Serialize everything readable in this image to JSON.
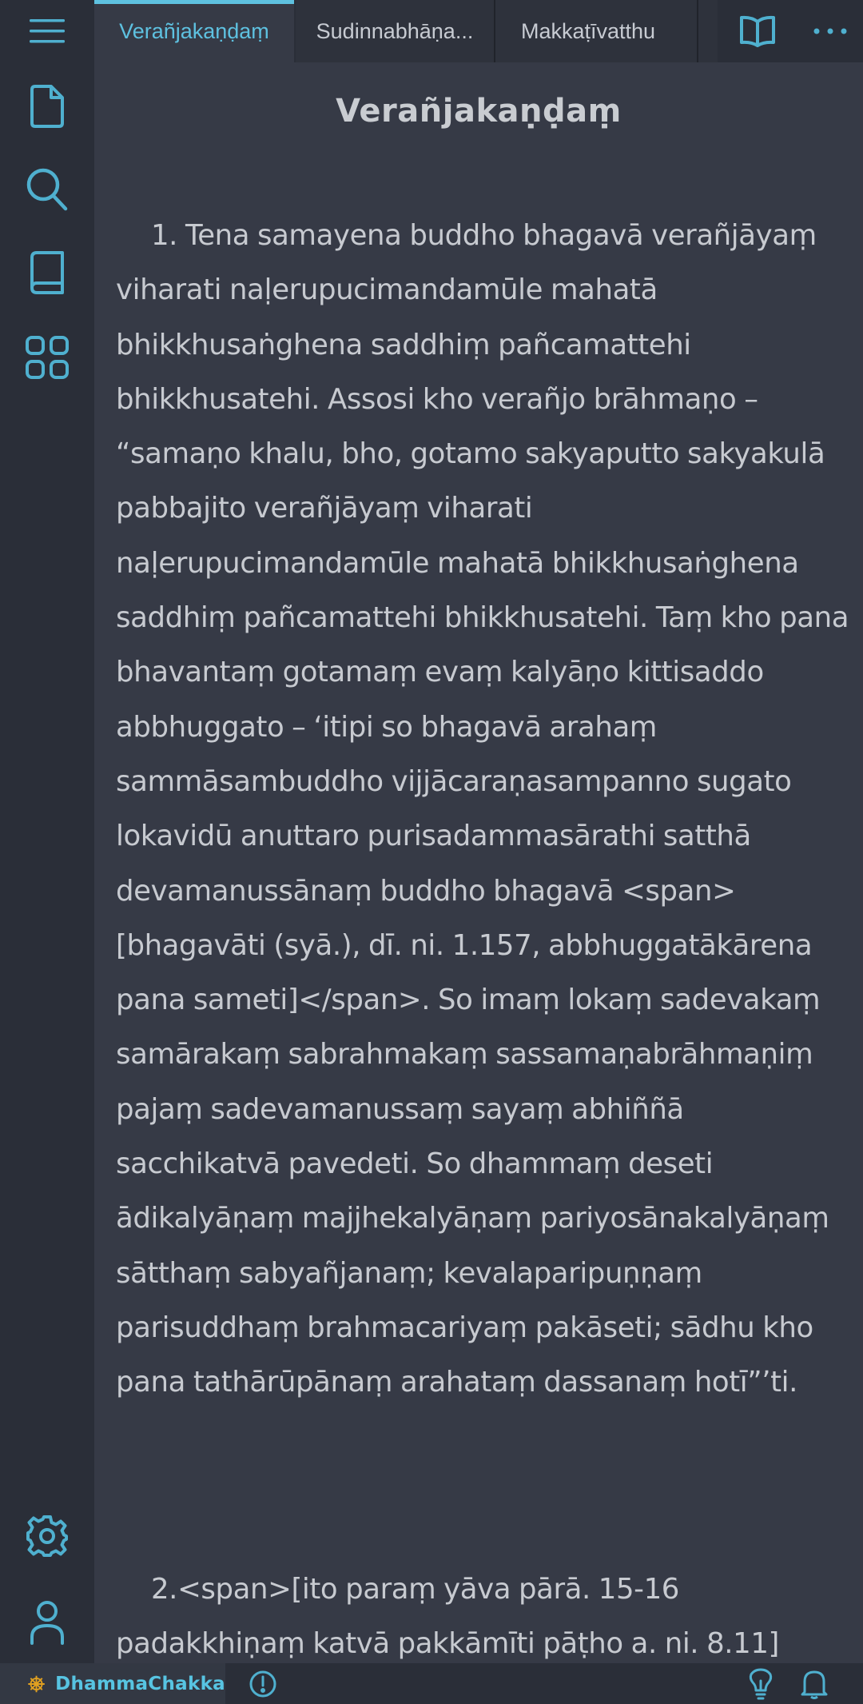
{
  "tabs": [
    {
      "label": "Verañjakaṇḍaṃ",
      "active": true
    },
    {
      "label": "Sudinnabhāṇa...",
      "active": false
    },
    {
      "label": "Makkaṭīvatthu",
      "active": false
    }
  ],
  "icons": {
    "menu": "menu-icon",
    "explorer": "file-icon",
    "search": "search-icon",
    "book": "book-icon",
    "extensions": "grid-icon",
    "settings": "gear-icon",
    "account": "person-icon",
    "reader_mode": "open-book-icon",
    "more": "more-icon",
    "brand": "dhamma-wheel-icon",
    "problems": "alert-icon",
    "tips": "lightbulb-icon",
    "notifications": "bell-icon"
  },
  "colors": {
    "accent": "#5ec1e0",
    "brand_wheel": "#e0a020",
    "text": "#c7cad0",
    "background": "#363a46",
    "sidebar": "#2a2e38"
  },
  "document": {
    "title": "Verañjakaṇḍaṃ",
    "paragraphs": [
      "1. Tena samayena buddho bhagavā verañjāyaṃ viharati naḷerupucimandamūle mahatā bhikkhusaṅghena saddhiṃ pañcamattehi bhikkhusatehi. Assosi kho verañjo brāhmaṇo – “samaṇo khalu, bho, gotamo sakyaputto sakyakulā pabbajito verañjāyaṃ viharati naḷerupucimandamūle mahatā bhikkhusaṅghena saddhiṃ pañcamattehi bhikkhusatehi. Taṃ kho pana bhavantaṃ gotamaṃ evaṃ kalyāṇo kittisaddo abbhuggato – ‘itipi so bhagavā arahaṃ sammāsambuddho vijjācaraṇasampanno sugato lokavidū anuttaro purisadammasārathi satthā devamanussānaṃ buddho bhagavā <span>[bhagavāti (syā.), dī. ni. 1.157, abbhuggatākārena pana sameti]</span>. So imaṃ lokaṃ sadevakaṃ samārakaṃ sabrahmakaṃ sassamaṇabrāhmaṇiṃ pajaṃ sadevamanussaṃ sayaṃ abhiññā sacchikatvā pavedeti. So dhammaṃ deseti ādikalyāṇaṃ majjhekalyāṇaṃ pariyosānakalyāṇaṃ sātthaṃ sabyañjanaṃ; kevalaparipuṇṇaṃ parisuddhaṃ brahmacariyaṃ pakāseti; sādhu kho pana tathārūpānaṃ arahataṃ dassanaṃ hotī”’ti.",
      "2.<span>[ito paraṃ yāva pārā. 15-16 padakkhiṇaṃ katvā pakkāmīti pāṭho a. ni. 8.11]"
    ]
  },
  "status_bar": {
    "brand": "DhammaChakka"
  }
}
